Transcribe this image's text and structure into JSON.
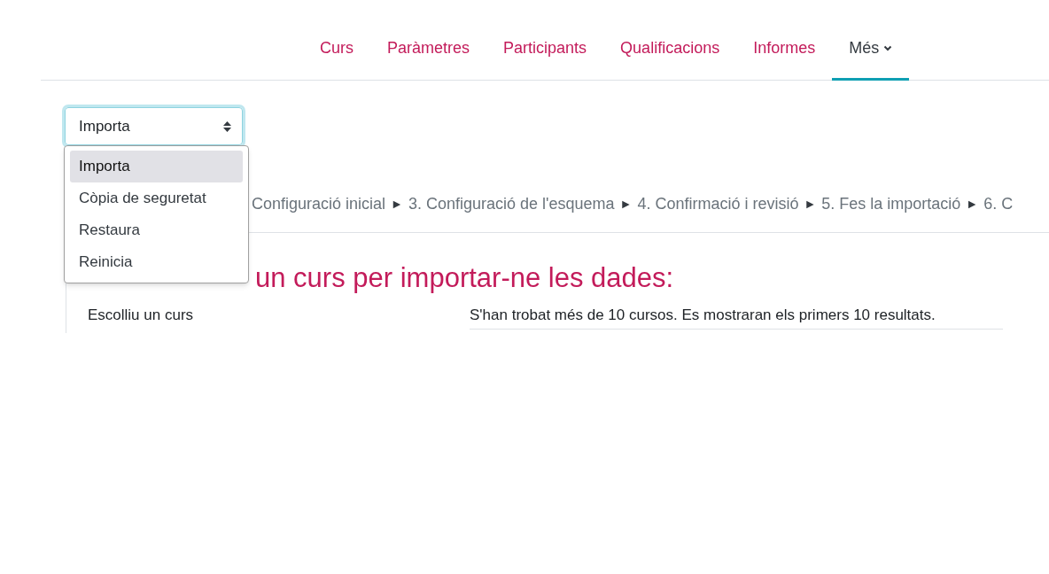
{
  "tabs": [
    {
      "label": "Curs",
      "selected": false,
      "has_caret": false
    },
    {
      "label": "Paràmetres",
      "selected": false,
      "has_caret": false
    },
    {
      "label": "Participants",
      "selected": false,
      "has_caret": false
    },
    {
      "label": "Qualificacions",
      "selected": false,
      "has_caret": false
    },
    {
      "label": "Informes",
      "selected": false,
      "has_caret": false
    },
    {
      "label": "Més",
      "selected": true,
      "has_caret": true
    }
  ],
  "action_select": {
    "value": "Importa",
    "expanded": true,
    "options": [
      {
        "label": "Importa",
        "selected": true
      },
      {
        "label": "Còpia de seguretat",
        "selected": false
      },
      {
        "label": "Restaura",
        "selected": false
      },
      {
        "label": "Reinicia",
        "selected": false
      }
    ]
  },
  "steps": {
    "separator": "►",
    "items": [
      "Configuració inicial",
      "3. Configuració de l'esquema",
      "4. Confirmació i revisió",
      "5. Fes la importació",
      "6. C"
    ]
  },
  "heading": "un curs per importar-ne les dades:",
  "form": {
    "label": "Escolliu un curs",
    "message": "S'han trobat més de 10 cursos. Es mostraran els primers 10 resultats."
  }
}
